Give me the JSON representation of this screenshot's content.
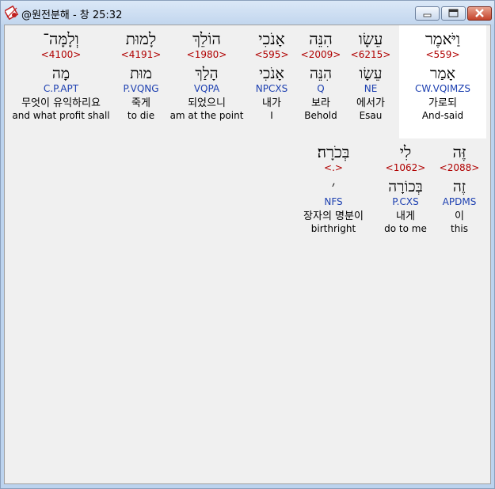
{
  "window": {
    "title": "@원전분해 - 창 25:32",
    "app_icon": "bible-app-icon",
    "controls": [
      "minimize",
      "maximize",
      "close"
    ]
  },
  "verse": {
    "line1": [
      {
        "hebrew": "וַיֹּאמֶר",
        "strong": "<559>",
        "lemma": "אָמַר",
        "parse": "CW.VQIMZS",
        "korean": "가로되",
        "english": "And-said",
        "highlighted": true
      },
      {
        "hebrew": "עֵשָׂו",
        "strong": "<6215>",
        "lemma": "עֵשָׂו",
        "parse": "NE",
        "korean": "에서가",
        "english": "Esau"
      },
      {
        "hebrew": "הִנֵּה",
        "strong": "<2009>",
        "lemma": "הִנֵּה",
        "parse": "Q",
        "korean": "보라",
        "english": "Behold"
      },
      {
        "hebrew": "אָנֹכִי",
        "strong": "<595>",
        "lemma": "אָנֹכִי",
        "parse": "NPCXS",
        "korean": "내가",
        "english": "I"
      },
      {
        "hebrew": "הוֹלֵךְ",
        "strong": "<1980>",
        "lemma": "הָלַךְ",
        "parse": "VQPA",
        "korean": "되었으니",
        "english": "am at the point"
      },
      {
        "hebrew": "לָמוּת",
        "strong": "<4191>",
        "lemma": "מוּת",
        "parse": "P.VQNG",
        "korean": "죽게",
        "english": "to die"
      },
      {
        "hebrew": "וְלָמָּה־",
        "strong": "<4100>",
        "lemma": "מָה",
        "parse": "C.P.APT",
        "korean": "무엇이 유익하리요",
        "english": "and what profit shall"
      }
    ],
    "line2": [
      {
        "hebrew": "זֶּה",
        "strong": "<2088>",
        "lemma": "זֶה",
        "parse": "APDMS",
        "korean": "이",
        "english": "this"
      },
      {
        "hebrew": "לִי",
        "strong": "<1062>",
        "lemma": "בְּכוֹרָה",
        "parse": "P.CXS",
        "korean": "내게",
        "english": "do to me"
      },
      {
        "hebrew": "בְּכֹרָה׃",
        "strong": "<.>",
        "lemma": "׳",
        "parse": "NFS",
        "korean": "장자의 명분이",
        "english": "birthright"
      }
    ]
  }
}
